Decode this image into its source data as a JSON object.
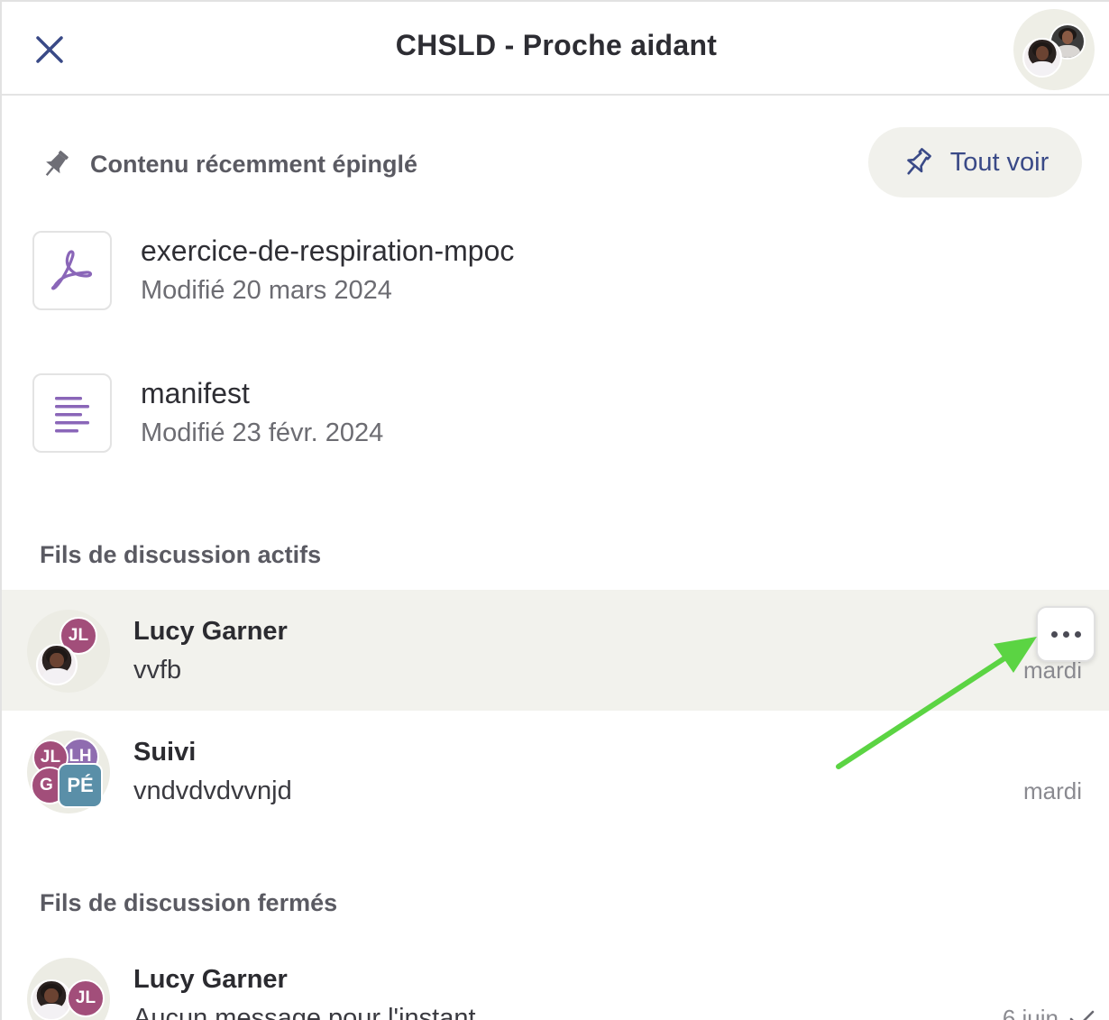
{
  "header": {
    "title": "CHSLD - Proche aidant",
    "close_icon": "close-icon"
  },
  "pinned": {
    "title": "Contenu récemment épinglé",
    "see_all_label": "Tout voir",
    "items": [
      {
        "name": "exercice-de-respiration-mpoc",
        "meta": "Modifié 20 mars 2024",
        "icon": "pdf-icon"
      },
      {
        "name": "manifest",
        "meta": "Modifié 23 févr. 2024",
        "icon": "document-icon"
      }
    ]
  },
  "active_threads": {
    "title": "Fils de discussion actifs",
    "items": [
      {
        "name": "Lucy Garner",
        "preview": "vvfb",
        "time": "mardi",
        "initials": [
          "JL"
        ]
      },
      {
        "name": "Suivi",
        "preview": "vndvdvdvvnjd",
        "time": "mardi",
        "initials": [
          "JL",
          "LH",
          "G",
          "PÉ"
        ]
      }
    ]
  },
  "closed_threads": {
    "title": "Fils de discussion fermés",
    "items": [
      {
        "name": "Lucy Garner",
        "preview": "Aucun message pour l'instant",
        "time": "6 juin",
        "initials": [
          "JL"
        ]
      }
    ]
  },
  "colors": {
    "accent": "#3a4a87",
    "avatar_magenta": "#a24e7a",
    "avatar_purple": "#8f6cb0",
    "avatar_teal": "#5a8fa8",
    "annotation_arrow": "#5bd443",
    "active_row_bg": "#f2f2ed"
  }
}
